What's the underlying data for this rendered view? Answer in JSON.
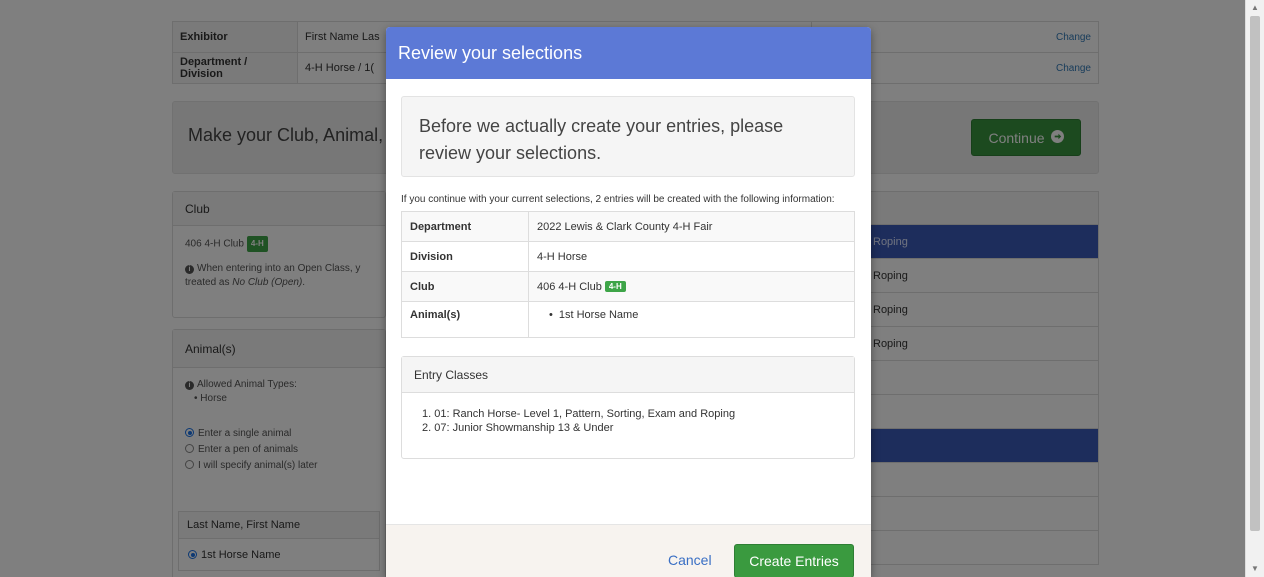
{
  "background": {
    "info_rows": [
      {
        "label": "Exhibitor",
        "value": "First Name Las",
        "action": "Change"
      },
      {
        "label": "Department / Division",
        "value": "4-H Horse / 1(",
        "action": "Change"
      }
    ],
    "cta_text": "Make your Club, Animal, a",
    "continue_label": "Continue",
    "club_panel": {
      "title": "Club",
      "club_name": "406 4-H Club",
      "badge": "4-H",
      "note_line1": "When entering into an Open Class, y",
      "note_line2_prefix": "treated as ",
      "note_line2_em": "No Club (Open)",
      "note_line2_suffix": "."
    },
    "animal_panel": {
      "title": "Animal(s)",
      "allowed_label": "Allowed Animal Types:",
      "allowed_type": "Horse",
      "options": [
        "Enter a single animal",
        "Enter a pen of animals",
        "I will specify animal(s) later"
      ],
      "selected_option": 0,
      "list_header": "Last Name, First Name",
      "animal_name": "1st Horse Name"
    },
    "right_rows": [
      "Roping",
      "Roping",
      "Roping",
      "Roping"
    ]
  },
  "modal": {
    "title": "Review your selections",
    "well_text": "Before we actually create your entries, please review your selections.",
    "intro": "If you continue with your current selections, 2 entries will be created with the following information:",
    "details": {
      "department_label": "Department",
      "department_value": "2022 Lewis & Clark County 4-H Fair",
      "division_label": "Division",
      "division_value": "4-H Horse",
      "club_label": "Club",
      "club_value": "406 4-H Club",
      "club_badge": "4-H",
      "animals_label": "Animal(s)",
      "animal_value": "1st Horse Name"
    },
    "classes_title": "Entry Classes",
    "classes": [
      "1. 01: Ranch Horse- Level 1, Pattern, Sorting, Exam and Roping",
      "2. 07: Junior Showmanship 13 & Under"
    ],
    "cancel_label": "Cancel",
    "create_label": "Create Entries"
  },
  "colors": {
    "modal_header": "#5c79d6",
    "primary_green": "#3a9a3f",
    "selected_row": "#3a5ab8",
    "badge_green": "#3ea548"
  }
}
